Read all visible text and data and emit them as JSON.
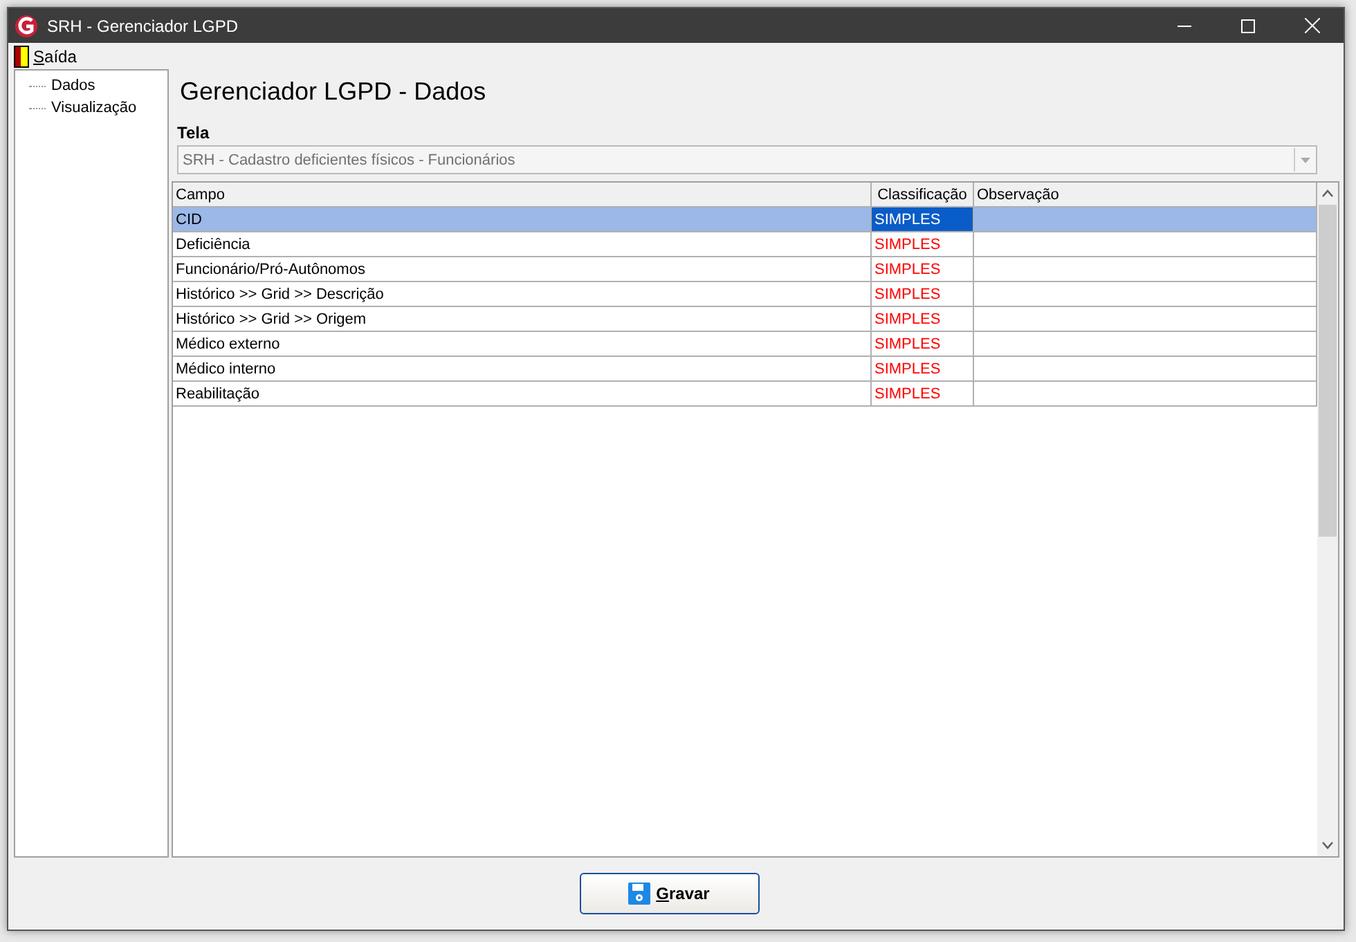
{
  "window": {
    "title": "SRH - Gerenciador LGPD"
  },
  "menu": [
    {
      "label": "Saída"
    }
  ],
  "tree": {
    "items": [
      {
        "label": "Dados",
        "selected": false
      },
      {
        "label": "Visualização",
        "selected": false
      }
    ]
  },
  "heading": "Gerenciador LGPD - Dados",
  "tela": {
    "label": "Tela",
    "value": "SRH - Cadastro deficientes físicos - Funcionários",
    "disabled": true
  },
  "table": {
    "columns": [
      "Campo",
      "Classificação",
      "Observação"
    ],
    "rows": [
      {
        "campo": "CID",
        "classificacao": "SIMPLES",
        "selected": true
      },
      {
        "campo": "Deficiência",
        "classificacao": "SIMPLES",
        "selected": false
      },
      {
        "campo": "Funcionário/Pró-Autônomos",
        "classificacao": "SIMPLES",
        "selected": false
      },
      {
        "campo": "Histórico >> Grid >> Descrição",
        "classificacao": "SIMPLES",
        "selected": false
      },
      {
        "campo": "Histórico >> Grid >> Origem",
        "classificacao": "SIMPLES",
        "selected": false
      },
      {
        "campo": "Médico externo",
        "classificacao": "SIMPLES",
        "selected": false
      },
      {
        "campo": "Médico interno",
        "classificacao": "SIMPLES",
        "selected": false
      },
      {
        "campo": "Reabilitação",
        "classificacao": "SIMPLES",
        "selected": false
      }
    ]
  },
  "buttons": [
    {
      "label": "Gravar"
    }
  ]
}
